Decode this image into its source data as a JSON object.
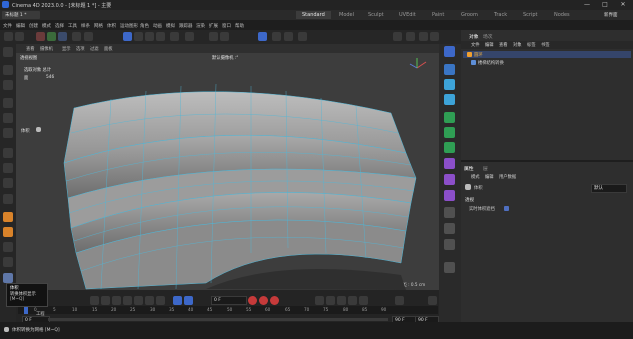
{
  "window": {
    "title": "Cinema 4D 2023.0.0 - [未标题 1 *] - 主要",
    "minimize": "—",
    "maximize": "□",
    "close": "✕"
  },
  "file_tabs": [
    "未标题 1 *"
  ],
  "menu": [
    "文件",
    "编辑",
    "创建",
    "模式",
    "选择",
    "工具",
    "样条",
    "网格",
    "体积",
    "运动图形",
    "角色",
    "动画",
    "模拟",
    "跟踪器",
    "渲染",
    "扩展",
    "窗口",
    "帮助"
  ],
  "workspace_tabs": [
    "Standard",
    "Model",
    "Sculpt",
    "UVEdit",
    "Paint",
    "Groom",
    "Track",
    "Script",
    "Nodes"
  ],
  "workspace_active": "Standard",
  "new_scene_label": "新界面",
  "viewport": {
    "menu": [
      "查看",
      "摄像机",
      "显示",
      "选项",
      "过滤",
      "面板"
    ],
    "name": "透视视图",
    "camera": "默认摄像机 :°",
    "selection_label": "选取对象 总计",
    "selection_count_label": "面",
    "selection_count": "546",
    "mode_label": "体积",
    "grid_spacing": "网格间距 : 0.5 cm"
  },
  "object_manager": {
    "tabs": [
      "对象",
      "场次"
    ],
    "menu": [
      "文件",
      "编辑",
      "查看",
      "对象",
      "标签",
      "书签"
    ],
    "objects": [
      {
        "name": "Ring",
        "label": "圆环"
      },
      {
        "name": "Tube",
        "label": "楼梯结构转换"
      }
    ]
  },
  "attribute_manager": {
    "tabs": [
      "属性",
      "层"
    ],
    "menu": [
      "模式",
      "编辑",
      "用户数据"
    ],
    "object_label": "体积",
    "mode_dropdown": "默认",
    "section": "透视",
    "checkbox_label": "实时体积遮挡"
  },
  "timeline": {
    "current_frame": "0 F",
    "start": "0 F",
    "end": "90 F",
    "end2": "90 F",
    "ticks": [
      "0",
      "5",
      "10",
      "15",
      "20",
      "25",
      "30",
      "35",
      "40",
      "45",
      "50",
      "55",
      "60",
      "65",
      "70",
      "75",
      "80",
      "85",
      "90"
    ]
  },
  "tooltip": {
    "line1": "体积",
    "line2": "转换体积显示",
    "line3": "[M~Q]",
    "line4": "工程"
  },
  "status": "体积转换为网格 [M~Q]"
}
